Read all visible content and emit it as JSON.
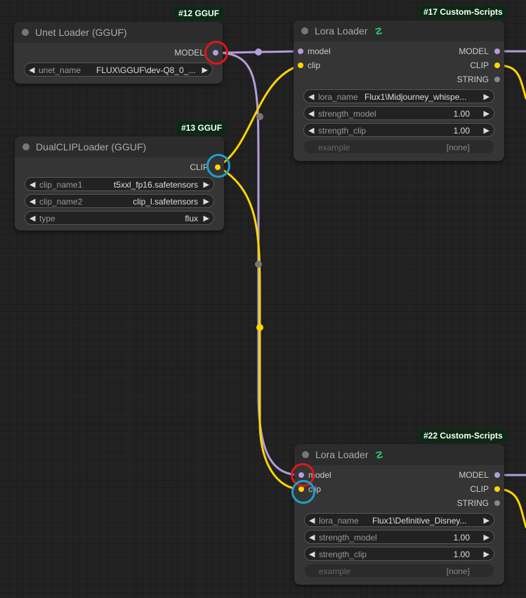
{
  "colors": {
    "model_link": "#b39ddb",
    "clip_link": "#ffd500",
    "string_slot": "#888888",
    "annotation_red": "#e0161b",
    "annotation_blue": "#1fa0c8",
    "badge_bg": "#0a2a14"
  },
  "nodes": {
    "unet": {
      "badge": "#12 GGUF",
      "title": "Unet Loader (GGUF)",
      "output_label": "MODEL",
      "widgets": [
        {
          "label": "unet_name",
          "value": "FLUX\\GGUF\\dev-Q8_0_..."
        }
      ]
    },
    "dualclip": {
      "badge": "#13 GGUF",
      "title": "DualCLIPLoader (GGUF)",
      "output_label": "CLIP",
      "widgets": [
        {
          "label": "clip_name1",
          "value": "t5xxl_fp16.safetensors"
        },
        {
          "label": "clip_name2",
          "value": "clip_l.safetensors"
        },
        {
          "label": "type",
          "value": "flux"
        }
      ]
    },
    "lora17": {
      "badge": "#17 Custom-Scripts",
      "title": "Lora Loader",
      "title_icon": "custom-scripts-icon",
      "inputs": [
        "model",
        "clip"
      ],
      "outputs": [
        "MODEL",
        "CLIP",
        "STRING"
      ],
      "widgets": [
        {
          "label": "lora_name",
          "value": "Flux1\\Midjourney_whispe..."
        },
        {
          "label": "strength_model",
          "value": "1.00"
        },
        {
          "label": "strength_clip",
          "value": "1.00"
        },
        {
          "label": "example",
          "value": "[none]"
        }
      ]
    },
    "lora22": {
      "badge": "#22 Custom-Scripts",
      "title": "Lora Loader",
      "title_icon": "custom-scripts-icon",
      "inputs": [
        "model",
        "clip"
      ],
      "outputs": [
        "MODEL",
        "CLIP",
        "STRING"
      ],
      "widgets": [
        {
          "label": "lora_name",
          "value": "Flux1\\Definitive_Disney..."
        },
        {
          "label": "strength_model",
          "value": "1.00"
        },
        {
          "label": "strength_clip",
          "value": "1.00"
        },
        {
          "label": "example",
          "value": "[none]"
        }
      ]
    }
  },
  "glyphs": {
    "left_arrow": "◀",
    "right_arrow": "▶",
    "custom_scripts": "☡"
  }
}
